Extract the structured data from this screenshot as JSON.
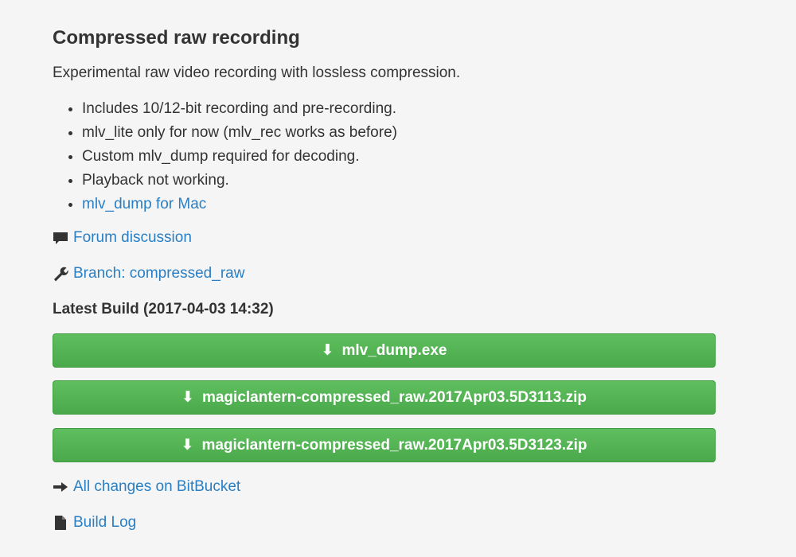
{
  "section": {
    "title": "Compressed raw recording",
    "description": "Experimental raw video recording with lossless compression."
  },
  "features": [
    "Includes 10/12-bit recording and pre-recording.",
    "mlv_lite only for now (mlv_rec works as before)",
    "Custom mlv_dump required for decoding.",
    "Playback not working.",
    "mlv_dump for Mac"
  ],
  "links": {
    "forum": "Forum discussion",
    "branch": "Branch: compressed_raw",
    "changes": "All changes on BitBucket",
    "build_log": "Build Log"
  },
  "build": {
    "heading": "Latest Build (2017-04-03 14:32)",
    "downloads": [
      "mlv_dump.exe",
      "magiclantern-compressed_raw.2017Apr03.5D3113.zip",
      "magiclantern-compressed_raw.2017Apr03.5D3123.zip"
    ],
    "arrow_glyph": "⬇"
  },
  "colors": {
    "link": "#2a7fc4",
    "button_green": "#4aa94a",
    "text": "#333333"
  },
  "icons": {
    "forum": "comment-icon",
    "branch": "wrench-icon",
    "changes": "arrow-right-icon",
    "build_log": "file-icon",
    "download": "download-arrow-icon"
  }
}
